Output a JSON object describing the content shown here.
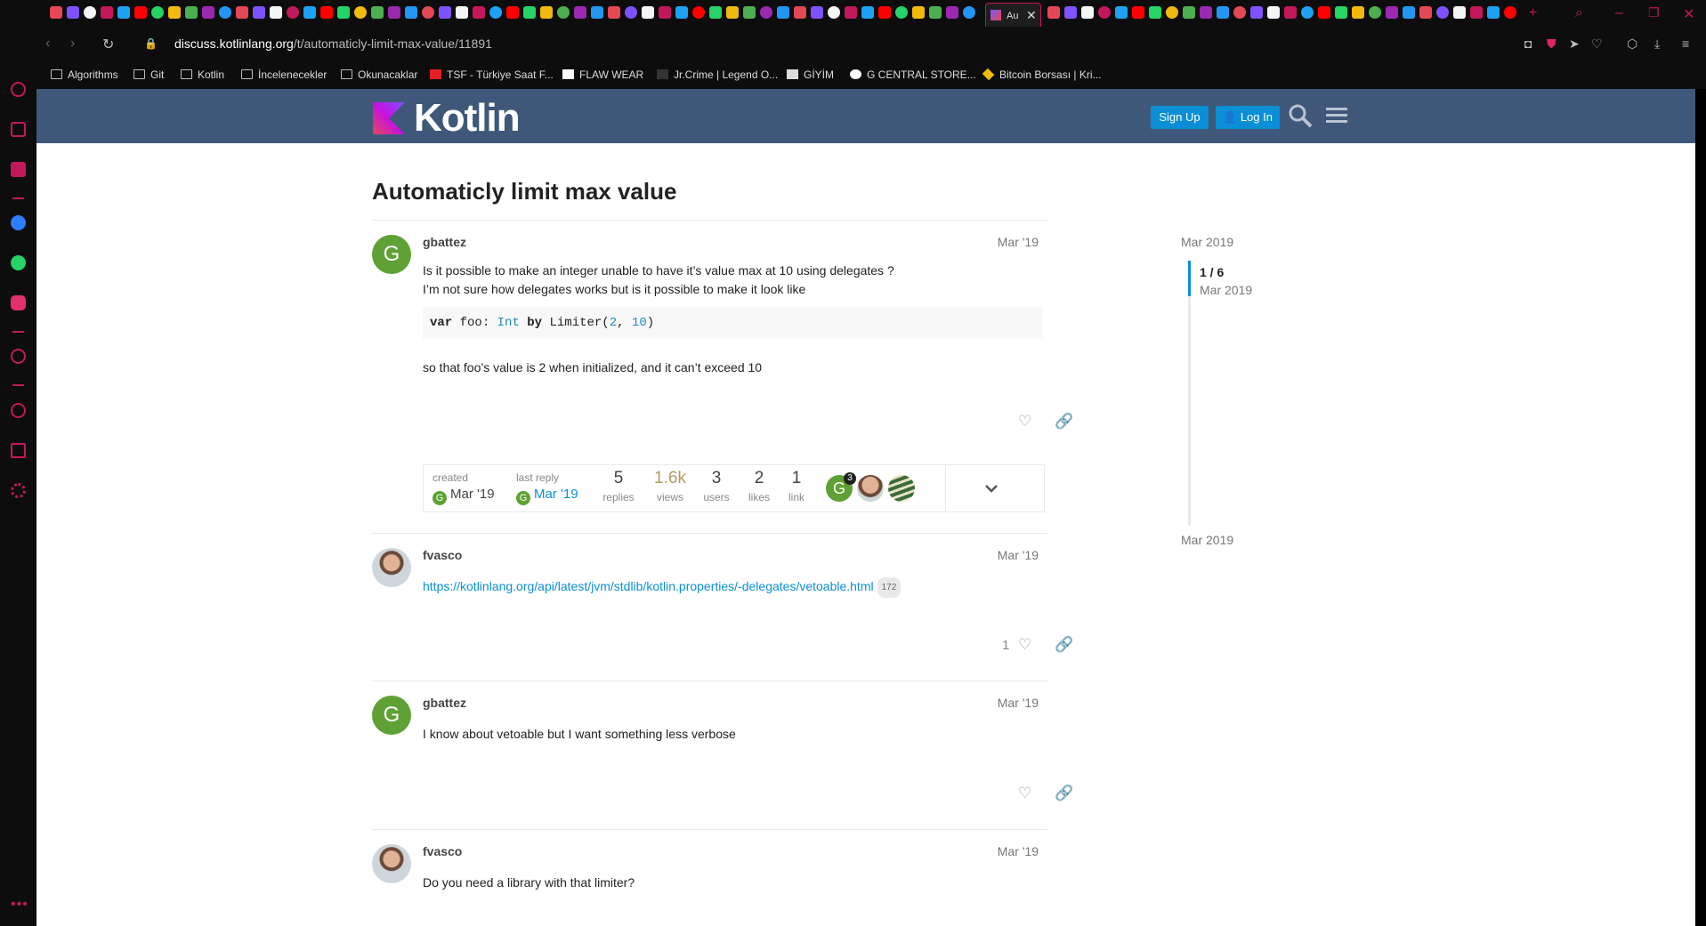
{
  "browser": {
    "active_tab_label": "Au",
    "url_host": "discuss.kotlinlang.org",
    "url_path": "/t/automaticly-limit-max-value/11891"
  },
  "bookmarks": [
    {
      "label": "Algorithms",
      "icon": "folder-icon"
    },
    {
      "label": "Git",
      "icon": "folder-icon"
    },
    {
      "label": "Kotlin",
      "icon": "folder-icon"
    },
    {
      "label": "İncelenecekler",
      "icon": "folder-icon"
    },
    {
      "label": "Okunacaklar",
      "icon": "folder-icon"
    },
    {
      "label": "TSF - Türkiye Saat F...",
      "icon": "tsf-icon"
    },
    {
      "label": "FLAW WEAR",
      "icon": "flaw-icon"
    },
    {
      "label": "Jr.Crime | Legend O...",
      "icon": "jrcrime-icon"
    },
    {
      "label": "GİYİM",
      "icon": "giyim-icon"
    },
    {
      "label": "G CENTRAL STORE...",
      "icon": "gcentral-icon"
    },
    {
      "label": "Bitcoin Borsası | Kri...",
      "icon": "binance-icon"
    }
  ],
  "header": {
    "logo_text": "Kotlin",
    "signup_label": "Sign Up",
    "login_label": "Log In"
  },
  "topic": {
    "title": "Automaticly limit max value"
  },
  "posts": [
    {
      "username": "gbattez",
      "avatar_letter": "G",
      "date": "Mar '19",
      "line1": "Is it possible to make an integer unable to have it’s value max at 10 using delegates ?",
      "line2": "I’m not sure how delegates works but is it possible to make it look like",
      "code": {
        "kw_var": "var",
        "name": "foo:",
        "type": "Int",
        "kw_by": "by",
        "call": "Limiter(",
        "arg1": "2",
        "sep": ",",
        "arg2": "10",
        "close": ")"
      },
      "line3": "so that foo’s value is 2 when initialized, and it can’t exceed 10"
    },
    {
      "username": "fvasco",
      "date": "Mar '19",
      "link": "https://kotlinlang.org/api/latest/jvm/stdlib/kotlin.properties/-delegates/vetoable.html",
      "link_clicks": "172",
      "like_count": "1"
    },
    {
      "username": "gbattez",
      "avatar_letter": "G",
      "date": "Mar '19",
      "text": "I know about vetoable but I want something less verbose"
    },
    {
      "username": "fvasco",
      "date": "Mar '19",
      "text": "Do you need a library with that limiter?"
    }
  ],
  "topic_map": {
    "created_label": "created",
    "created_date": "Mar '19",
    "last_reply_label": "last reply",
    "last_reply_date": "Mar '19",
    "replies": "5",
    "replies_label": "replies",
    "views": "1.6k",
    "views_label": "views",
    "users": "3",
    "users_label": "users",
    "likes": "2",
    "likes_label": "likes",
    "links": "1",
    "links_label": "link",
    "participant_badge": "3"
  },
  "timeline": {
    "top_date": "Mar 2019",
    "position": "1 / 6",
    "position_date": "Mar 2019",
    "bottom_date": "Mar 2019"
  },
  "colors": {
    "accent": "#0a8fd6",
    "header_bg": "#3f587a",
    "browser_accent": "#c2185b",
    "avatar_green": "#5fa134"
  }
}
